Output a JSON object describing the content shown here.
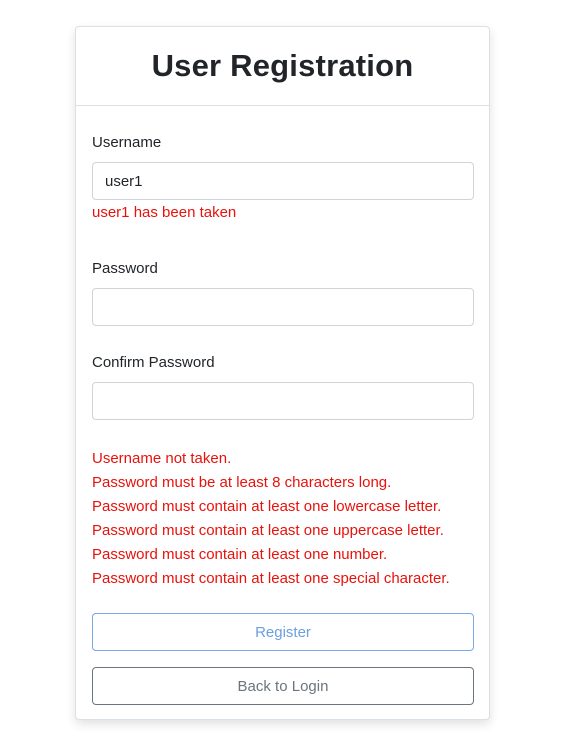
{
  "title": "User Registration",
  "form": {
    "username": {
      "label": "Username",
      "value": "user1",
      "error": "user1 has been taken"
    },
    "password": {
      "label": "Password",
      "value": ""
    },
    "confirm_password": {
      "label": "Confirm Password",
      "value": ""
    }
  },
  "validation_messages": [
    "Username not taken.",
    "Password must be at least 8 characters long.",
    "Password must contain at least one lowercase letter.",
    "Password must contain at least one uppercase letter.",
    "Password must contain at least one number.",
    "Password must contain at least one special character."
  ],
  "buttons": {
    "register": "Register",
    "back_to_login": "Back to Login"
  },
  "colors": {
    "error": "#e8120c",
    "primary_outline": "#6c9fe0",
    "secondary_outline": "#6c757d"
  }
}
